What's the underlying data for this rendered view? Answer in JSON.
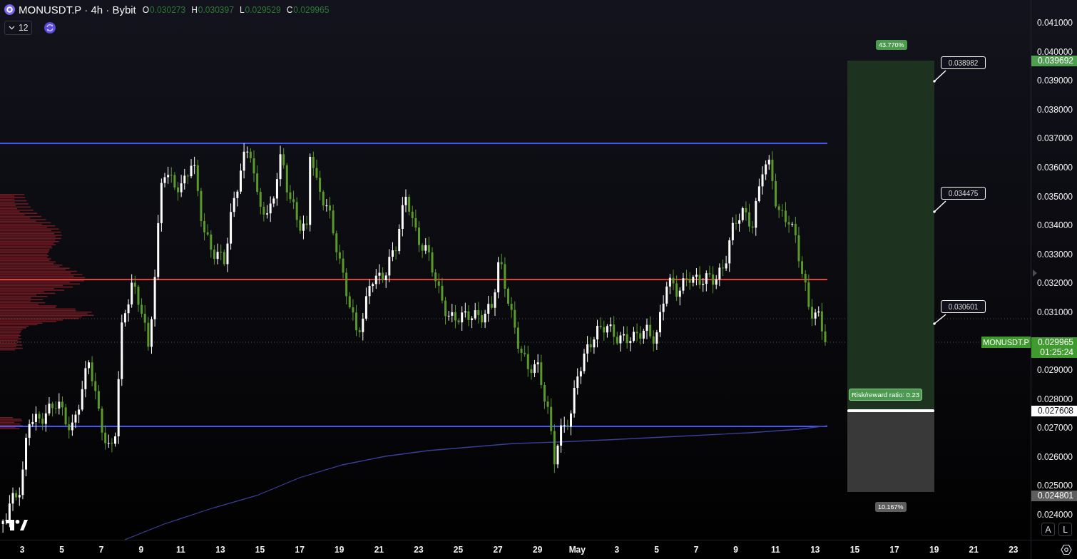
{
  "header": {
    "symbol_title": "MONUSDT.P · 4h · Bybit",
    "ohlc": [
      {
        "label": "O",
        "value": "0.030273"
      },
      {
        "label": "H",
        "value": "0.030397"
      },
      {
        "label": "L",
        "value": "0.029529"
      },
      {
        "label": "C",
        "value": "0.029965"
      }
    ]
  },
  "indicators_button": {
    "count": "12"
  },
  "position_tool": {
    "profit_percent": "43.770%",
    "ratio": "Risk/reward ratio: 0.23",
    "loss_percent": "10.167%"
  },
  "callouts": [
    {
      "value": "0.038982"
    },
    {
      "value": "0.034475"
    },
    {
      "value": "0.030601"
    }
  ],
  "price_axis": {
    "labels": [
      "0.041000",
      "0.040000",
      "0.039000",
      "0.038000",
      "0.037000",
      "0.036000",
      "0.035000",
      "0.034000",
      "0.033000",
      "0.032000",
      "0.031000",
      "0.029000",
      "0.028000",
      "0.027000",
      "0.026000",
      "0.025000",
      "0.024000"
    ]
  },
  "price_tags": [
    {
      "kind": "target",
      "text": "0.039692"
    },
    {
      "kind": "last",
      "symbol": "MONUSDT.P",
      "text": "0.029965",
      "countdown": "01:25:24"
    },
    {
      "kind": "entry",
      "text": "0.027608"
    },
    {
      "kind": "stop",
      "text": "0.024801"
    }
  ],
  "time_axis": {
    "labels": [
      "3",
      "5",
      "7",
      "9",
      "11",
      "13",
      "15",
      "17",
      "19",
      "21",
      "23",
      "25",
      "27",
      "29",
      "May",
      "3",
      "5",
      "7",
      "9",
      "11",
      "13",
      "15",
      "17",
      "19",
      "21",
      "23"
    ]
  },
  "scale_buttons": [
    {
      "label": "A"
    },
    {
      "label": "L"
    }
  ]
}
